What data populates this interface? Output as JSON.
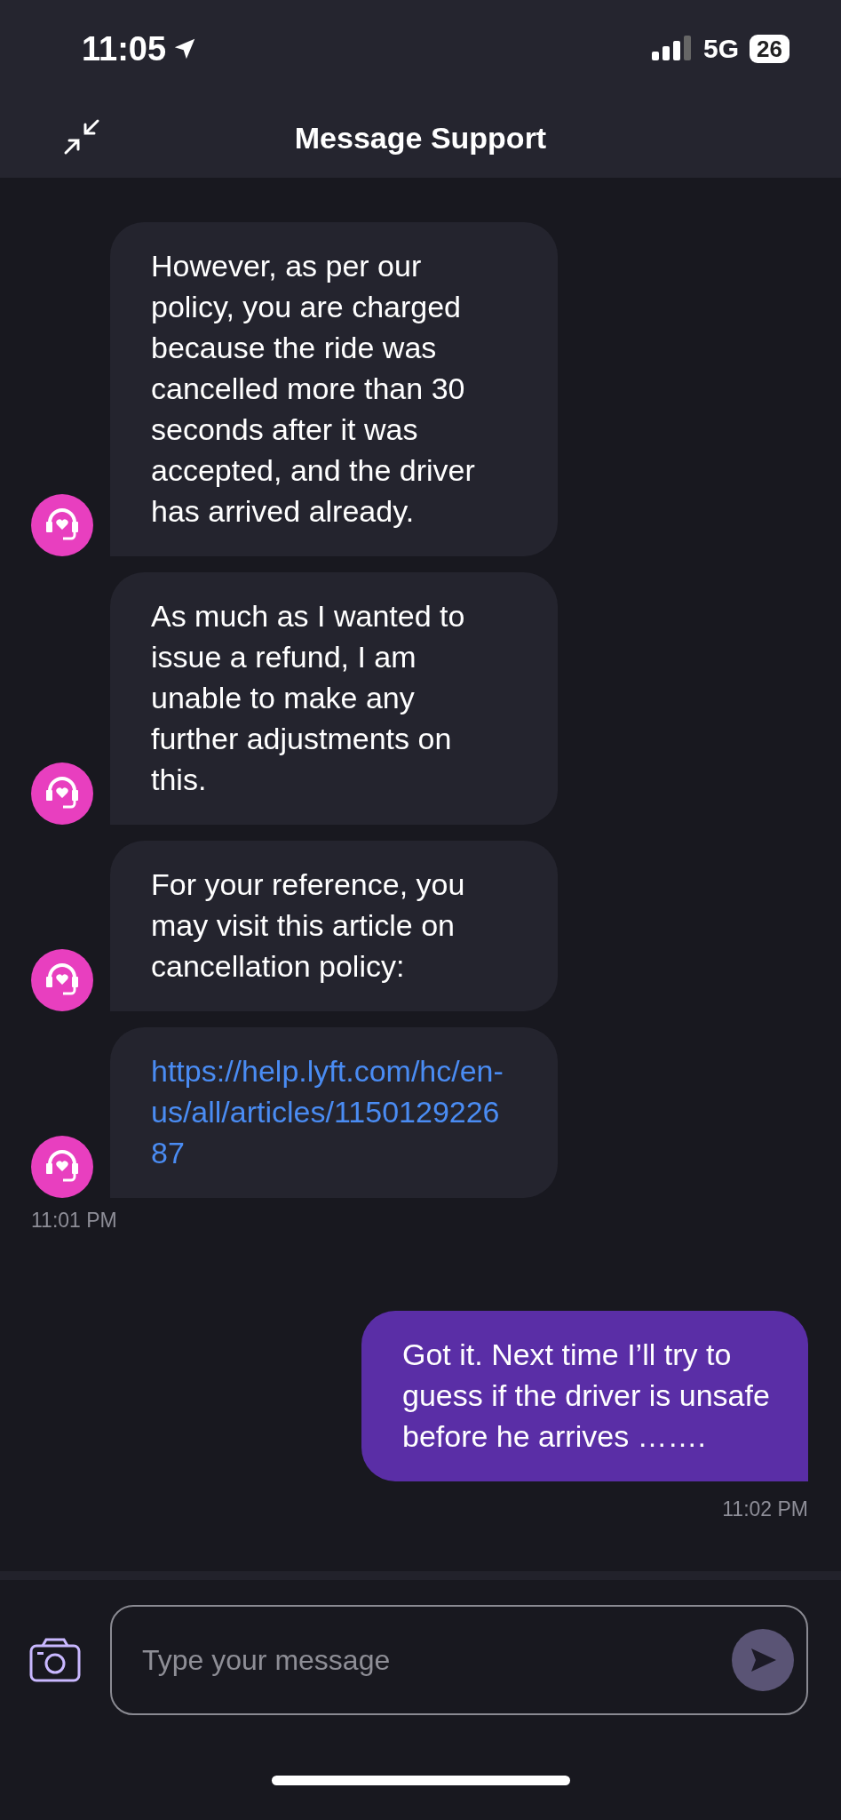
{
  "status_bar": {
    "time": "11:05",
    "network": "5G",
    "battery": "26"
  },
  "header": {
    "title": "Message Support"
  },
  "messages": [
    {
      "kind": "agent-text",
      "text": "However, as per our policy, you are charged because the ride was cancelled more than 30 seconds after it was accepted, and the driver has arrived already."
    },
    {
      "kind": "agent-text",
      "text": "As much as I wanted to issue a refund, I am unable to make any further adjustments on this."
    },
    {
      "kind": "agent-text",
      "text": "For your reference, you may visit this article on cancellation policy:"
    },
    {
      "kind": "agent-link",
      "text": "https://help.lyft.com/hc/en-us/all/articles/115012922687"
    },
    {
      "kind": "agent-time",
      "text": "11:01 PM"
    },
    {
      "kind": "user-text",
      "text": "Got it. Next time I’ll try to guess if the driver is unsafe before he arrives ……."
    },
    {
      "kind": "user-time",
      "text": "11:02 PM"
    }
  ],
  "composer": {
    "placeholder": "Type your message"
  }
}
